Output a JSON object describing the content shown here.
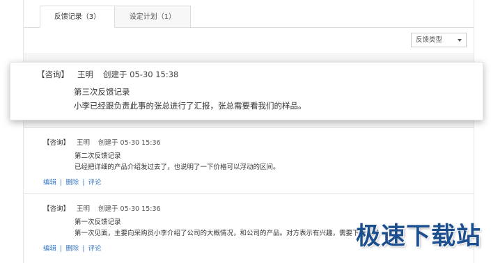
{
  "tabs": [
    {
      "label": "反馈记录（3）",
      "active": true
    },
    {
      "label": "设定计划（1）",
      "active": false
    }
  ],
  "filter": {
    "selected": "反馈类型"
  },
  "popup": {
    "type": "【咨询】",
    "author": "王明",
    "created": "创建于 05-30 15:38",
    "title": "第三次反馈记录",
    "content": "小李已经跟负责此事的张总进行了汇报，张总需要看我们的样品。"
  },
  "records": [
    {
      "type": "【咨询】",
      "author": "王明",
      "created": "创建于 05-30 15:36",
      "title": "第二次反馈记录",
      "content": "已经把详细的产品介绍发过去了，也说明了一下价格可以浮动的区间。",
      "actions": {
        "edit": "编辑",
        "delete": "删除",
        "comment": "评论"
      }
    },
    {
      "type": "【咨询】",
      "author": "王明",
      "created": "创建于 05-30 15:36",
      "title": "第一次反馈记录",
      "content": "第一次见面，主要向采购员小李介绍了公司的大概情况，和公司的产品。对方表示有兴趣，需要下一步进",
      "actions": {
        "edit": "编辑",
        "delete": "删除",
        "comment": "评论"
      }
    }
  ],
  "action_separator": "|",
  "watermark": "极速下载站"
}
